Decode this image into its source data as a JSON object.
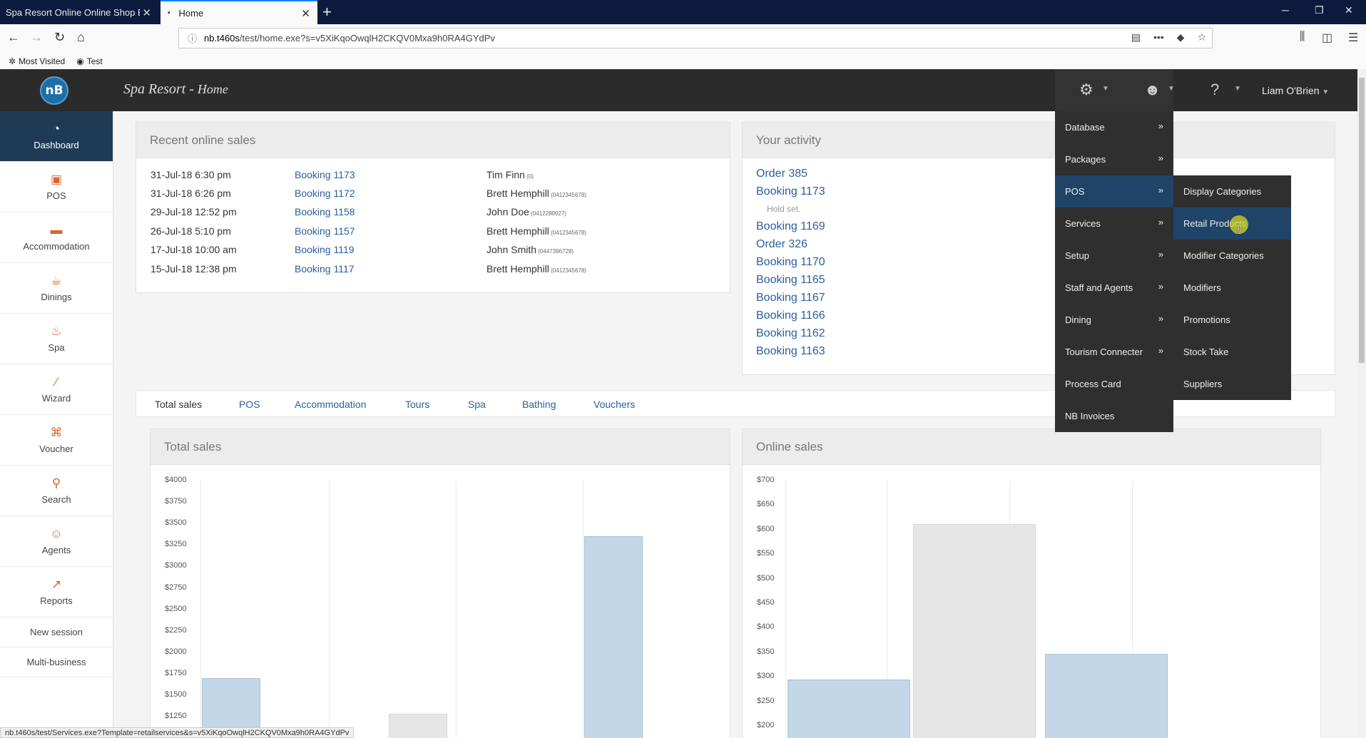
{
  "browser": {
    "tabs": [
      {
        "title": "Spa Resort Online Online Shop Boo"
      },
      {
        "title": "Home"
      }
    ],
    "url_host": "nb.t460s",
    "url_path": "/test/home.exe?s=v5XiKqoOwqlH2CKQV0Mxa9h0RA4GYdPv",
    "bookmarks": [
      "Most Visited",
      "Test"
    ],
    "status_url": "nb.t460s/test/Services.exe?Template=retailservices&s=v5XiKqoOwqlH2CKQV0Mxa9h0RA4GYdPv"
  },
  "app": {
    "logo": "nB",
    "title": "Spa Resort -",
    "subtitle": "Home",
    "user": "Liam O'Brien"
  },
  "sidebar": {
    "items": [
      {
        "label": "Dashboard",
        "icon": "dashboard-icon"
      },
      {
        "label": "POS",
        "icon": "pos-icon"
      },
      {
        "label": "Accommodation",
        "icon": "bed-icon"
      },
      {
        "label": "Dinings",
        "icon": "dining-icon"
      },
      {
        "label": "Spa",
        "icon": "spa-icon"
      },
      {
        "label": "Wizard",
        "icon": "wand-icon"
      },
      {
        "label": "Voucher",
        "icon": "gift-icon"
      },
      {
        "label": "Search",
        "icon": "search-icon"
      },
      {
        "label": "Agents",
        "icon": "agent-icon"
      },
      {
        "label": "Reports",
        "icon": "chart-icon"
      }
    ],
    "plain": [
      "New session",
      "Multi-business"
    ]
  },
  "recent_sales": {
    "title": "Recent online sales",
    "rows": [
      {
        "date": "31-Jul-18 6:30 pm",
        "booking": "Booking 1173",
        "name": "Tim Finn",
        "phone": "(0)"
      },
      {
        "date": "31-Jul-18 6:26 pm",
        "booking": "Booking 1172",
        "name": "Brett Hemphill",
        "phone": "(0412345678)"
      },
      {
        "date": "29-Jul-18 12:52 pm",
        "booking": "Booking 1158",
        "name": "John Doe",
        "phone": "(0412280027)"
      },
      {
        "date": "26-Jul-18 5:10 pm",
        "booking": "Booking 1157",
        "name": "Brett Hemphill",
        "phone": "(0412345678)"
      },
      {
        "date": "17-Jul-18 10:00 am",
        "booking": "Booking 1119",
        "name": "John Smith",
        "phone": "(0447396728)"
      },
      {
        "date": "15-Jul-18 12:38 pm",
        "booking": "Booking 1117",
        "name": "Brett Hemphill",
        "phone": "(0412345678)"
      }
    ]
  },
  "activity": {
    "title": "Your activity",
    "items": [
      "Order 385",
      "Booking 1173",
      "Booking 1169",
      "Order 326",
      "Booking 1170",
      "Booking 1165",
      "Booking 1167",
      "Booking 1166",
      "Booking 1162",
      "Booking 1163"
    ],
    "hold_note": "Hold set."
  },
  "sales_tabs": [
    "Total sales",
    "POS",
    "Accommodation",
    "Tours",
    "Spa",
    "Bathing",
    "Vouchers"
  ],
  "chart_data": [
    {
      "type": "bar",
      "title": "Total sales",
      "y_ticks": [
        "$4000",
        "$3750",
        "$3500",
        "$3250",
        "$3000",
        "$2750",
        "$2500",
        "$2250",
        "$2000",
        "$1750",
        "$1500",
        "$1250"
      ],
      "bars": [
        {
          "value": 1700,
          "style": "blue"
        },
        {
          "value": 1280,
          "style": "grey"
        },
        {
          "value": 3350,
          "style": "blue"
        }
      ]
    },
    {
      "type": "bar",
      "title": "Online sales",
      "y_ticks": [
        "$700",
        "$650",
        "$600",
        "$550",
        "$500",
        "$450",
        "$400",
        "$350",
        "$300",
        "$250",
        "$200"
      ],
      "bars": [
        {
          "value": 295,
          "style": "blue"
        },
        {
          "value": 612,
          "style": "grey"
        },
        {
          "value": 347,
          "style": "blue"
        }
      ]
    }
  ],
  "settings_menu": {
    "items": [
      "Database",
      "Packages",
      "POS",
      "Services",
      "Setup",
      "Staff and Agents",
      "Dining",
      "Tourism Connecter",
      "Process Card",
      "NB Invoices"
    ],
    "arrow": "»"
  },
  "pos_submenu": {
    "items": [
      "Display Categories",
      "Retail Products",
      "Modifier Categories",
      "Modifiers",
      "Promotions",
      "Stock Take",
      "Suppliers"
    ]
  }
}
